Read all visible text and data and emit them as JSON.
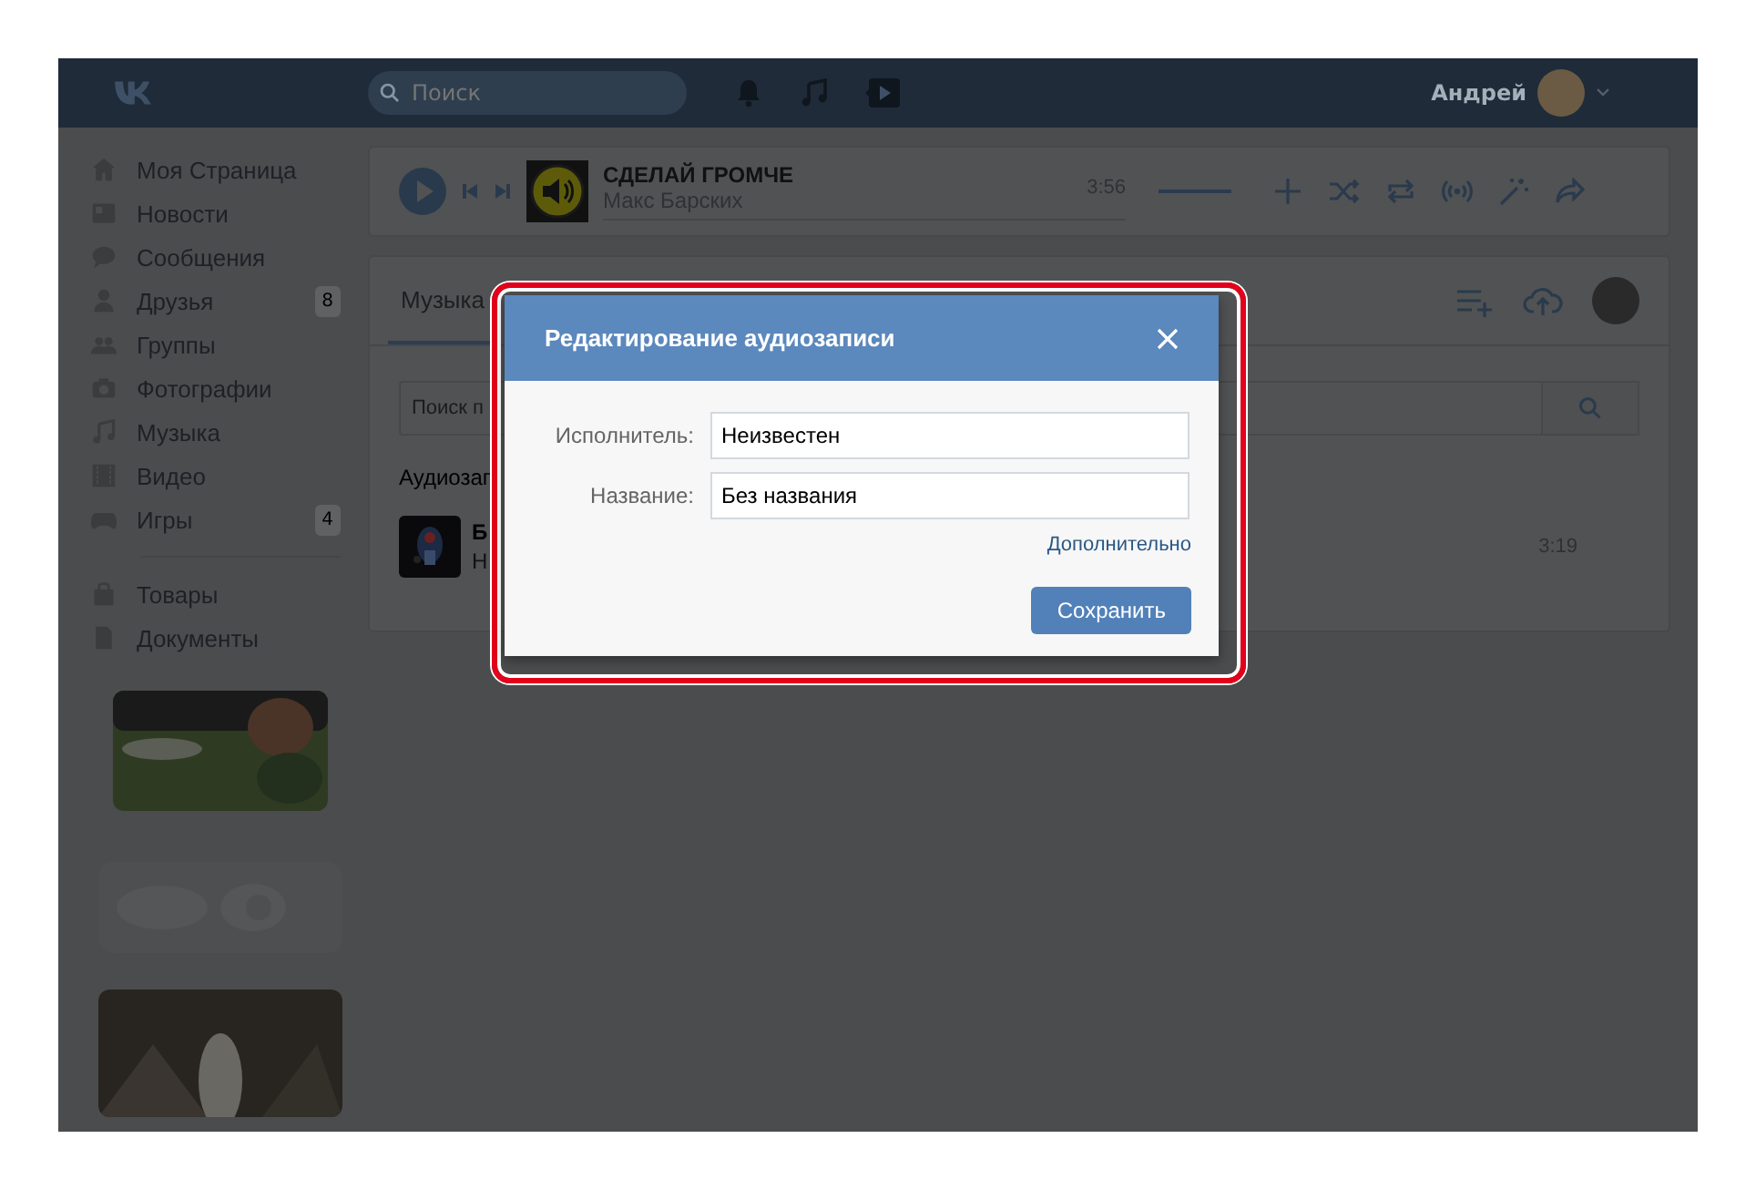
{
  "header": {
    "search": {
      "placeholder": "Поиск"
    },
    "user_name": "Андрей"
  },
  "sidebar": {
    "groups": [
      {
        "items": [
          {
            "kind": "home",
            "label": "Моя Страница"
          },
          {
            "kind": "news",
            "label": "Новости"
          },
          {
            "kind": "messages",
            "label": "Сообщения"
          },
          {
            "kind": "friends",
            "label": "Друзья",
            "badge": "8"
          },
          {
            "kind": "groups",
            "label": "Группы"
          },
          {
            "kind": "photos",
            "label": "Фотографии"
          },
          {
            "kind": "music",
            "label": "Музыка"
          },
          {
            "kind": "video",
            "label": "Видео"
          },
          {
            "kind": "games",
            "label": "Игры",
            "badge": "4"
          }
        ]
      },
      {
        "items": [
          {
            "kind": "market",
            "label": "Товары"
          },
          {
            "kind": "docs",
            "label": "Документы"
          }
        ]
      }
    ]
  },
  "player": {
    "title": "СДЕЛАЙ ГРОМЧЕ",
    "artist": "Макс Барских",
    "duration": "3:56",
    "volume": {
      "level": 1
    }
  },
  "music": {
    "tabs": [
      {
        "label": "Музыка",
        "selected": true
      }
    ],
    "search": {
      "placeholder": "Поиск п"
    },
    "section_title": "Аудиозап",
    "tracks": [
      {
        "title": "Б",
        "artist": "Н",
        "duration": "3:19"
      }
    ]
  },
  "dialog": {
    "title": "Редактирование аудиозаписи",
    "fields": [
      {
        "label": "Исполнитель:",
        "value": "Неизвестен"
      },
      {
        "label": "Название:",
        "value": "Без названия"
      }
    ],
    "more_link": "Дополнительно",
    "save_button": "Сохранить"
  }
}
